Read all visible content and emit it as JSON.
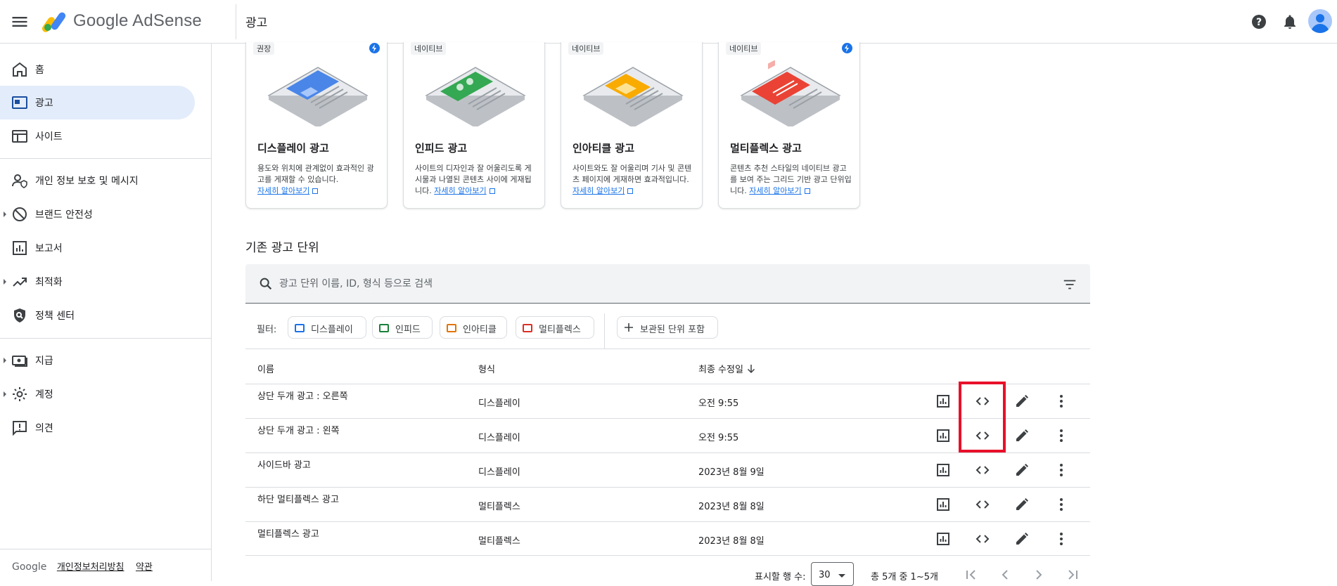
{
  "header": {
    "brand": "Google AdSense",
    "page_title": "광고"
  },
  "sidebar": {
    "items": [
      {
        "label": "홈",
        "icon": "home-icon"
      },
      {
        "label": "광고",
        "icon": "ads-icon",
        "active": true
      },
      {
        "label": "사이트",
        "icon": "sites-icon"
      },
      {
        "label": "개인 정보 보호 및 메시지",
        "icon": "privacy-icon"
      },
      {
        "label": "브랜드 안전성",
        "icon": "block-icon"
      },
      {
        "label": "보고서",
        "icon": "reports-icon"
      },
      {
        "label": "최적화",
        "icon": "trending-icon"
      },
      {
        "label": "정책 센터",
        "icon": "policy-icon"
      },
      {
        "label": "지급",
        "icon": "payments-icon"
      },
      {
        "label": "계정",
        "icon": "gear-icon"
      },
      {
        "label": "의견",
        "icon": "feedback-icon"
      }
    ],
    "footer": {
      "google": "Google",
      "privacy": "개인정보처리방침",
      "terms": "약관"
    }
  },
  "cards": [
    {
      "tag": "권장",
      "title": "디스플레이 광고",
      "desc": "용도와 위치에 관계없이 효과적인 광고를 게재할 수 있습니다.",
      "link": "자세히 알아보기",
      "color": "#4a86e8"
    },
    {
      "tag": "네이티브",
      "title": "인피드 광고",
      "desc": "사이트의 디자인과 잘 어울리도록 게시물과 나열된 콘텐츠 사이에 게재됩니다.",
      "link": "자세히 알아보기",
      "color": "#34a853"
    },
    {
      "tag": "네이티브",
      "title": "인아티클 광고",
      "desc": "사이트와도 잘 어울리며 기사 및 콘텐츠 페이지에 게재하면 효과적입니다.",
      "link": "자세히 알아보기",
      "color": "#f9ab00"
    },
    {
      "tag": "네이티브",
      "title": "멀티플렉스 광고",
      "desc": "콘텐츠 추천 스타일의 네이티브 광고를 보여 주는 그리드 기반 광고 단위입니다.",
      "link": "자세히 알아보기",
      "color": "#ea4335"
    }
  ],
  "existing": {
    "title": "기존 광고 단위",
    "search_placeholder": "광고 단위 이름, ID, 형식 등으로 검색",
    "filter_label": "필터:",
    "chips": [
      {
        "label": "디스플레이",
        "color": "#1a73e8"
      },
      {
        "label": "인피드",
        "color": "#188038"
      },
      {
        "label": "인아티클",
        "color": "#e37400"
      },
      {
        "label": "멀티플렉스",
        "color": "#d93025"
      }
    ],
    "archived_chip": "보관된 단위 포함",
    "columns": {
      "name": "이름",
      "format": "형식",
      "modified": "최종 수정일"
    },
    "rows": [
      {
        "name": "상단 두개 광고 : 오른쪽",
        "format": "디스플레이",
        "modified": "오전 9:55"
      },
      {
        "name": "상단 두개 광고 : 왼쪽",
        "format": "디스플레이",
        "modified": "오전 9:55"
      },
      {
        "name": "사이드바 광고",
        "format": "디스플레이",
        "modified": "2023년 8월 9일"
      },
      {
        "name": "하단 멀티플렉스 광고",
        "format": "멀티플렉스",
        "modified": "2023년 8월 8일"
      },
      {
        "name": "멀티플렉스 광고",
        "format": "멀티플렉스",
        "modified": "2023년 8월 8일"
      }
    ]
  },
  "pager": {
    "rows_label": "표시할 행 수:",
    "rows_value": "30",
    "range": "총 5개 중 1~5개"
  },
  "colors": {
    "accent": "#1a73e8",
    "highlight": "#e8102a",
    "active_nav": "#e3ecfa"
  }
}
